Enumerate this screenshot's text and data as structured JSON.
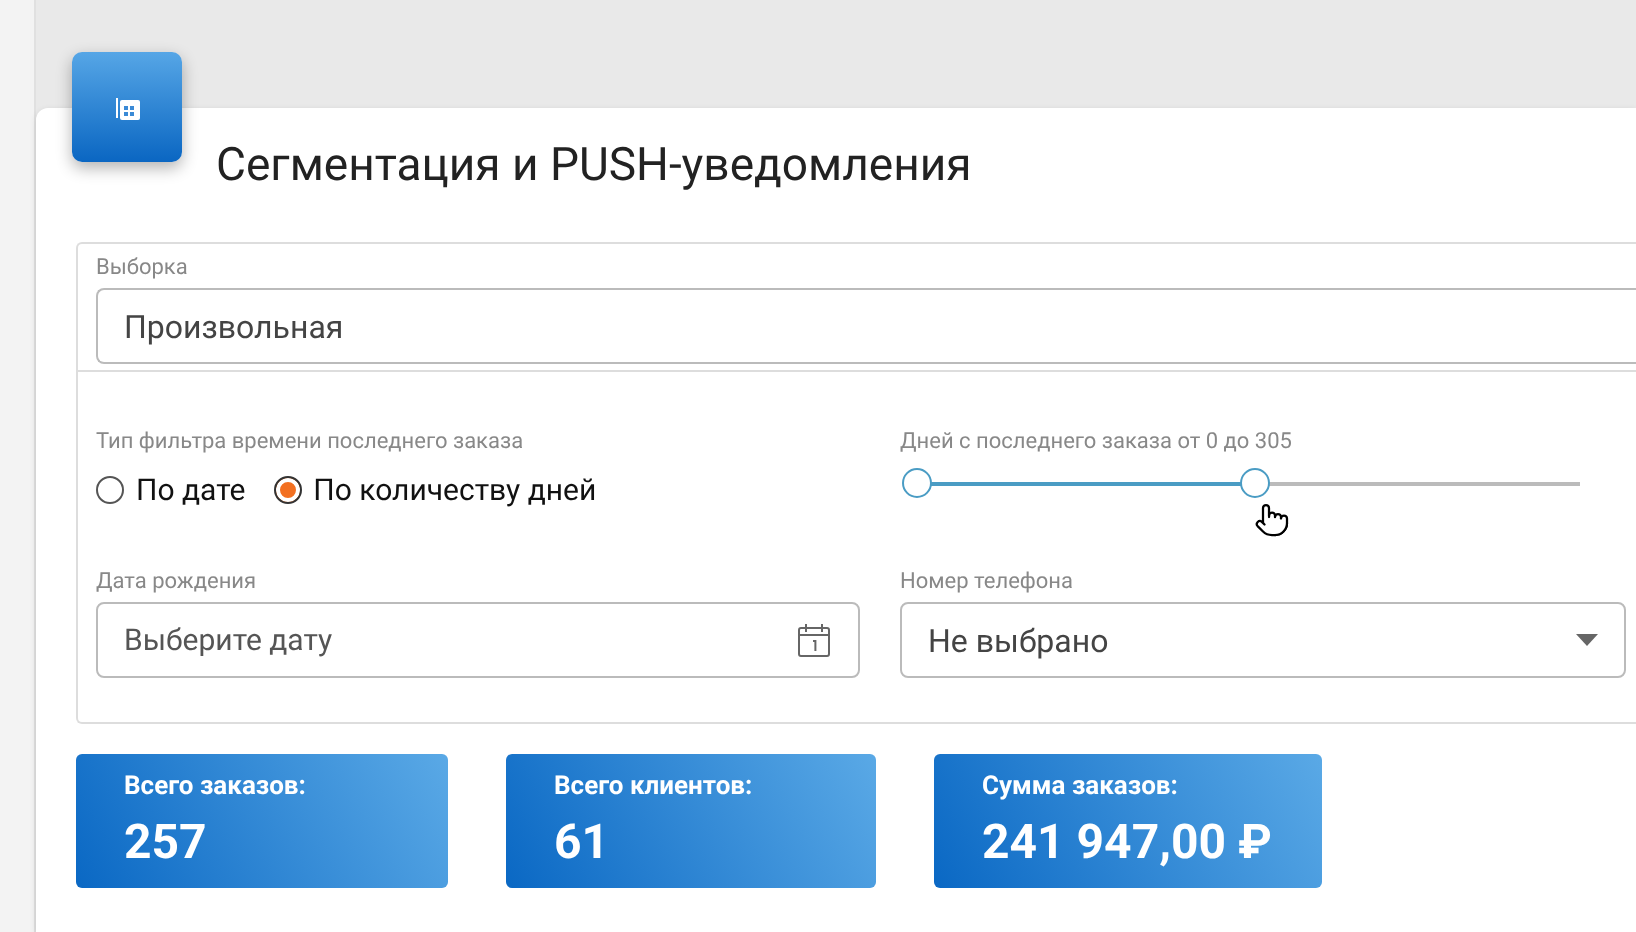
{
  "header": {
    "title": "Сегментация и PUSH-уведомления"
  },
  "selection": {
    "label": "Выборка",
    "value": "Произвольная"
  },
  "filter_type": {
    "label": "Тип фильтра времени последнего заказа",
    "options": [
      {
        "label": "По дате",
        "selected": false
      },
      {
        "label": "По количеству дней",
        "selected": true
      }
    ]
  },
  "days_slider": {
    "label": "Дней с последнего заказа от 0 до 305",
    "level": 0.51
  },
  "birth_date": {
    "label": "Дата рождения",
    "placeholder": "Выберите дату"
  },
  "phone": {
    "label": "Номер телефона",
    "value": "Не выбрано"
  },
  "stats": [
    {
      "label": "Всего заказов:",
      "value": "257"
    },
    {
      "label": "Всего клиентов:",
      "value": "61"
    },
    {
      "label": "Сумма заказов:",
      "value": "241 947,00 ₽"
    }
  ]
}
